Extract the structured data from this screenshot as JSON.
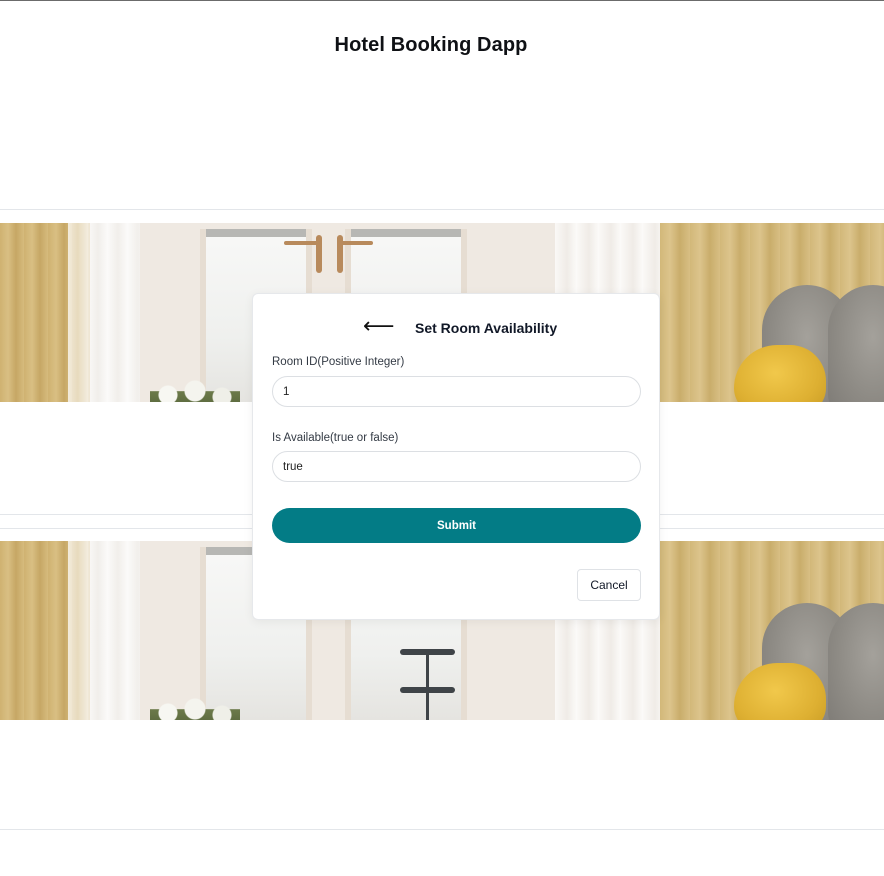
{
  "app": {
    "title": "Hotel Booking Dapp"
  },
  "rooms": [
    {
      "image": "hotel-room-photo"
    },
    {
      "image": "hotel-room-photo"
    }
  ],
  "modal": {
    "back_icon": "arrow-left-icon",
    "back_glyph": "⟵",
    "title": "Set Room Availability",
    "fields": [
      {
        "label": "Room ID(Positive Integer)",
        "value": "1"
      },
      {
        "label": "Is Available(true or false)",
        "value": "true"
      }
    ],
    "submit_label": "Submit",
    "cancel_label": "Cancel"
  },
  "colors": {
    "accent": "#037c86",
    "title_text": "#0f1115",
    "border": "#dcdfe3"
  }
}
